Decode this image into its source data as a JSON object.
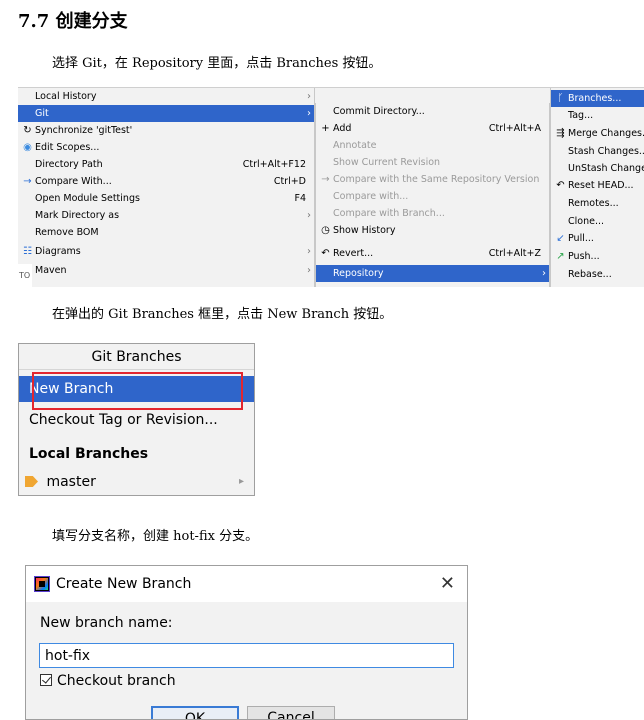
{
  "heading": {
    "num": "7.7",
    "title": "创建分支"
  },
  "para1": "选择 Git，在 Repository 里面，点击 Branches 按钮。",
  "para2": "在弹出的 Git Branches 框里，点击 New Branch 按钮。",
  "para3": "填写分支名称，创建 hot-fix 分支。",
  "menu1": {
    "items": [
      {
        "label": "Local History",
        "icon": "",
        "shortcut": "",
        "arrow": "›"
      },
      {
        "label": "Git",
        "icon": "",
        "shortcut": "",
        "arrow": "›"
      },
      {
        "label": "Synchronize 'gitTest'",
        "icon": "↻",
        "shortcut": "",
        "arrow": ""
      },
      {
        "label": "Edit Scopes...",
        "icon": "◉",
        "shortcut": "",
        "arrow": ""
      },
      {
        "label": "Directory Path",
        "icon": "",
        "shortcut": "Ctrl+Alt+F12",
        "arrow": ""
      },
      {
        "label": "Compare With...",
        "icon": "→",
        "shortcut": "Ctrl+D",
        "arrow": ""
      },
      {
        "label": "Open Module Settings",
        "icon": "",
        "shortcut": "F4",
        "arrow": ""
      },
      {
        "label": "Mark Directory as",
        "icon": "",
        "shortcut": "",
        "arrow": "›"
      },
      {
        "label": "Remove BOM",
        "icon": "",
        "shortcut": "",
        "arrow": ""
      },
      {
        "label": "Diagrams",
        "icon": "☷",
        "shortcut": "",
        "arrow": "›"
      },
      {
        "label": "Maven",
        "icon": "m",
        "shortcut": "",
        "arrow": "›"
      }
    ],
    "gutter": "TO"
  },
  "menu2": {
    "items": [
      {
        "label": "Commit Directory...",
        "icon": "",
        "shortcut": "",
        "arrow": ""
      },
      {
        "label": "Add",
        "icon": "+",
        "shortcut": "Ctrl+Alt+A",
        "arrow": ""
      },
      {
        "label": "Annotate",
        "icon": "",
        "shortcut": "",
        "arrow": ""
      },
      {
        "label": "Show Current Revision",
        "icon": "",
        "shortcut": "",
        "arrow": ""
      },
      {
        "label": "Compare with the Same Repository Version",
        "icon": "→",
        "shortcut": "",
        "arrow": ""
      },
      {
        "label": "Compare with...",
        "icon": "",
        "shortcut": "",
        "arrow": ""
      },
      {
        "label": "Compare with Branch...",
        "icon": "",
        "shortcut": "",
        "arrow": ""
      },
      {
        "label": "Show History",
        "icon": "◷",
        "shortcut": "",
        "arrow": ""
      },
      {
        "label": "Revert...",
        "icon": "↶",
        "shortcut": "Ctrl+Alt+Z",
        "arrow": ""
      },
      {
        "label": "Repository",
        "icon": "",
        "shortcut": "",
        "arrow": "›"
      }
    ]
  },
  "menu3": {
    "items": [
      {
        "label": "Branches...",
        "icon": "ᚴ"
      },
      {
        "label": "Tag...",
        "icon": ""
      },
      {
        "label": "Merge Changes...",
        "icon": "⇶"
      },
      {
        "label": "Stash Changes...",
        "icon": ""
      },
      {
        "label": "UnStash Changes...",
        "icon": ""
      },
      {
        "label": "Reset HEAD...",
        "icon": "↶"
      },
      {
        "label": "Remotes...",
        "icon": ""
      },
      {
        "label": "Clone...",
        "icon": ""
      },
      {
        "label": "Pull...",
        "icon": "↙"
      },
      {
        "label": "Push...",
        "icon": "↗"
      },
      {
        "label": "Rebase...",
        "icon": ""
      }
    ]
  },
  "git_branches": {
    "title": "Git Branches",
    "new_branch": "New Branch",
    "checkout": "Checkout Tag or Revision...",
    "local_header": "Local Branches",
    "branch": "master",
    "arrow": "▸"
  },
  "dialog": {
    "title": "Create New Branch",
    "close": "✕",
    "label": "New branch name:",
    "value": "hot-fix",
    "checkbox_label": "Checkout branch",
    "ok": "OK",
    "cancel": "Cancel"
  }
}
